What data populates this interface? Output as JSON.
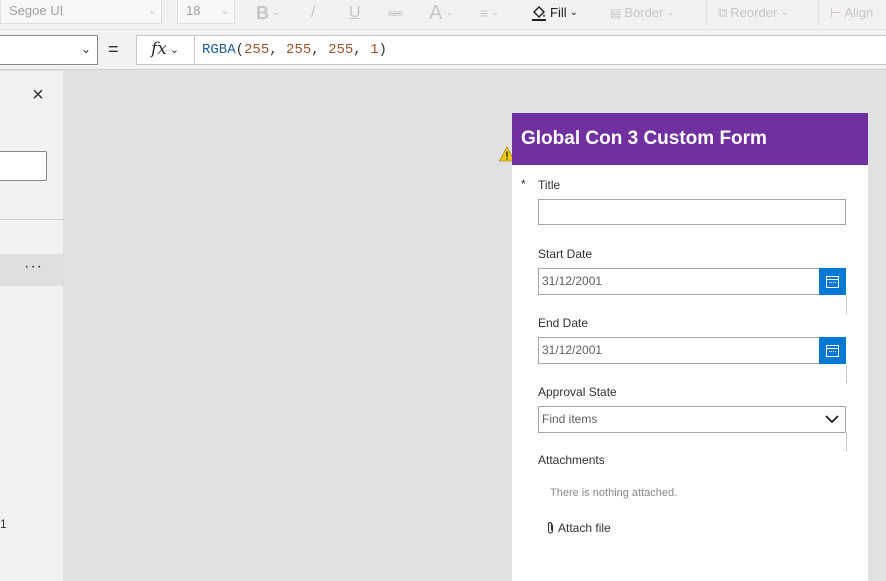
{
  "toolbar": {
    "font_name": "Segoe UI",
    "font_size": "18",
    "bold": "B",
    "italic": "/",
    "underline": "U",
    "strikethrough": "abc",
    "font_color": "A",
    "fill_label": "Fill",
    "border_label": "Border",
    "reorder_label": "Reorder",
    "align_label": "Align"
  },
  "formula_bar": {
    "equals": "=",
    "fx": "fx",
    "formula_fn": "RGBA",
    "formula_args": [
      "255",
      "255",
      "255",
      "1"
    ]
  },
  "left_panel": {
    "close": "×",
    "more": "···",
    "number": "1"
  },
  "form": {
    "title": "Global Con 3 Custom Form",
    "header_color": "#7030a0",
    "fields": {
      "title": {
        "required_mark": "*",
        "label": "Title",
        "value": ""
      },
      "start_date": {
        "label": "Start Date",
        "value": "31/12/2001"
      },
      "end_date": {
        "label": "End Date",
        "value": "31/12/2001"
      },
      "approval_state": {
        "label": "Approval State",
        "placeholder": "Find items"
      },
      "attachments": {
        "label": "Attachments",
        "empty_message": "There is nothing attached.",
        "attach_label": "Attach file"
      }
    }
  },
  "colors": {
    "accent": "#0078d4",
    "warning": "#f2c811"
  }
}
